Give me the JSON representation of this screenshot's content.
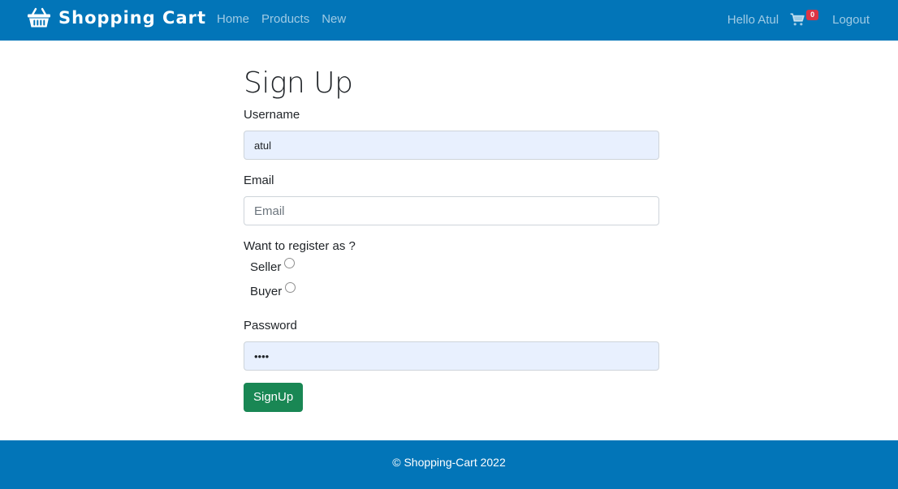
{
  "navbar": {
    "brand_icon": "shopping-basket-icon",
    "brand": "Shopping Cart",
    "links": [
      {
        "label": "Home"
      },
      {
        "label": "Products"
      },
      {
        "label": "New"
      }
    ],
    "greeting": "Hello Atul",
    "cart_icon": "shopping-cart-icon",
    "cart_count": "0",
    "logout": "Logout",
    "color": "#0275b8"
  },
  "form": {
    "title": "Sign Up",
    "username": {
      "label": "Username",
      "value": "atul"
    },
    "email": {
      "label": "Email",
      "value": "",
      "placeholder": "Email"
    },
    "role": {
      "question": "Want to register as ?",
      "options": [
        {
          "label": "Seller",
          "checked": false
        },
        {
          "label": "Buyer",
          "checked": false
        }
      ]
    },
    "password": {
      "label": "Password",
      "value": "••••"
    },
    "submit": "SignUp",
    "submit_color": "#198754"
  },
  "footer": {
    "text": "© Shopping-Cart 2022"
  }
}
